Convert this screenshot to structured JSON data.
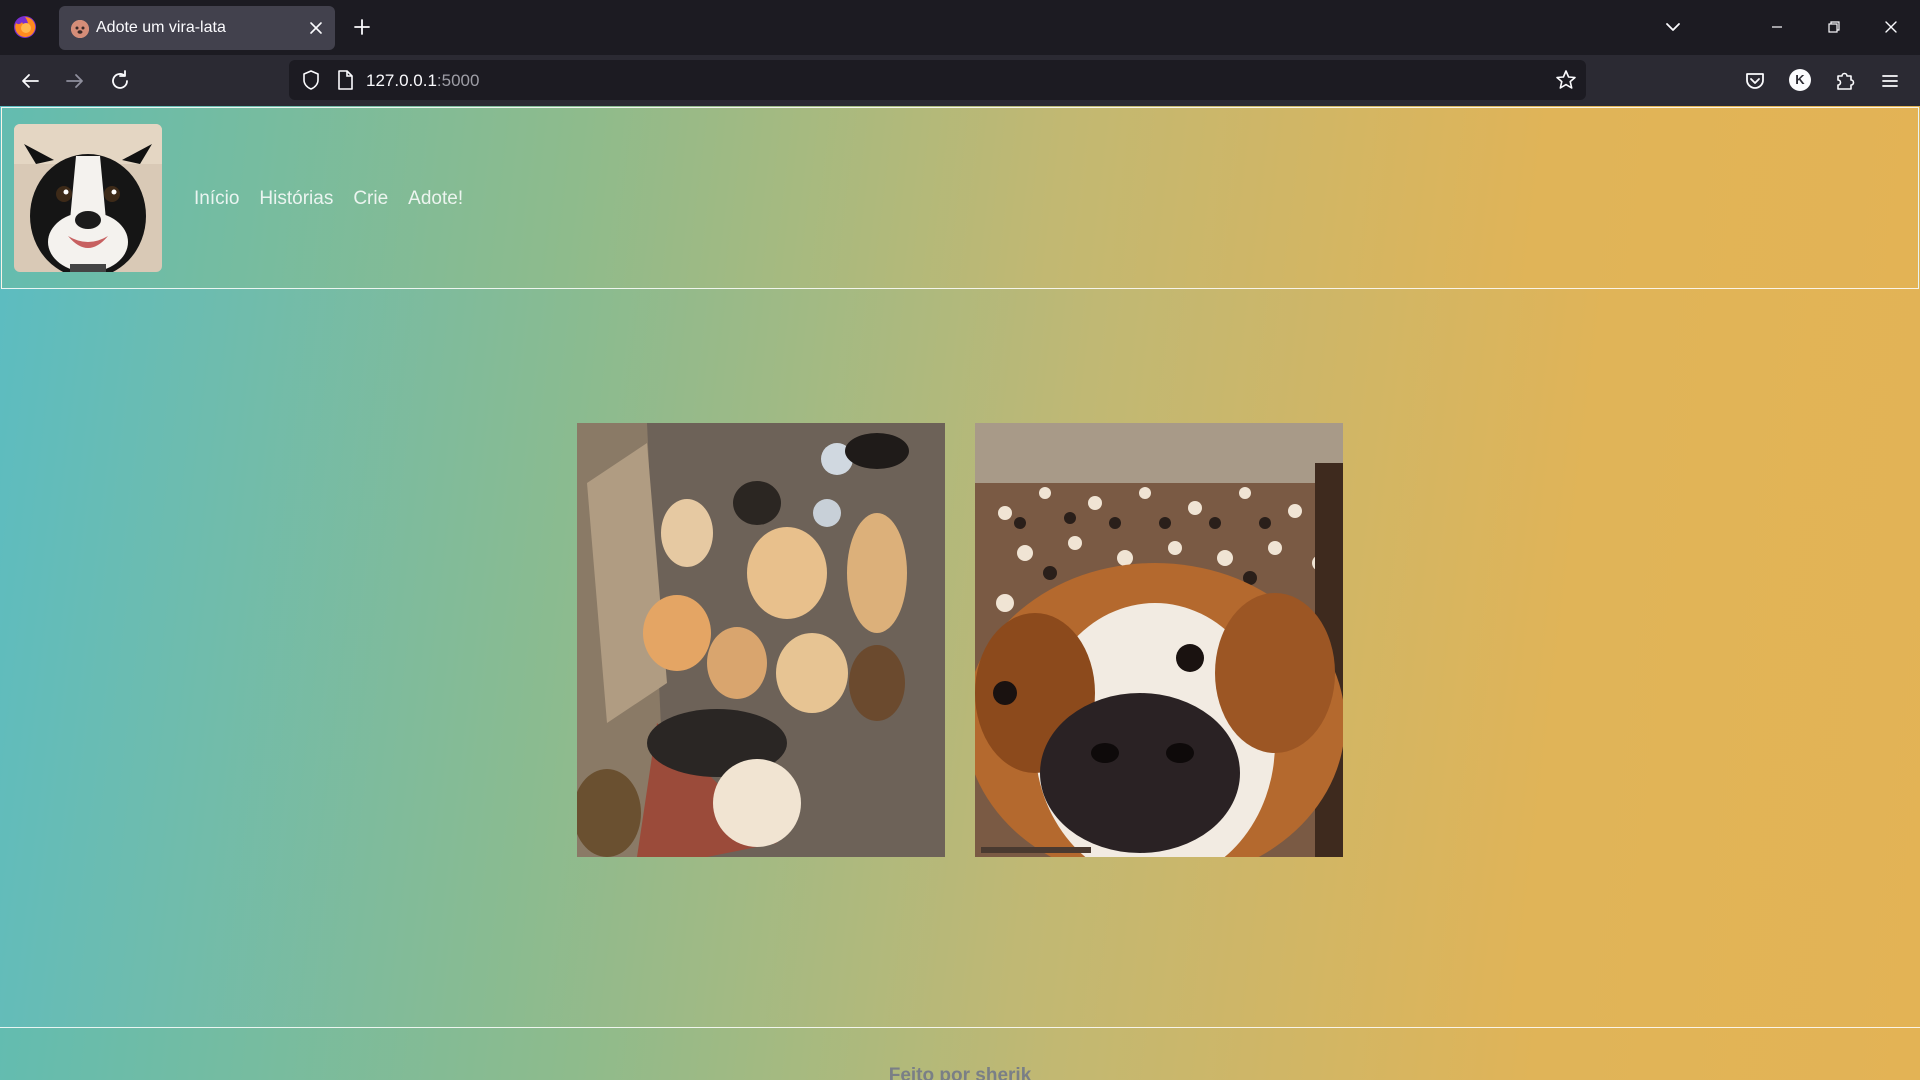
{
  "browser": {
    "tab": {
      "title": "Adote um vira-lata"
    },
    "url": {
      "host": "127.0.0.1",
      "port": ":5000"
    }
  },
  "site": {
    "menu": [
      {
        "label": "Início"
      },
      {
        "label": "Histórias"
      },
      {
        "label": "Crie"
      },
      {
        "label": "Adote!"
      }
    ],
    "footer": {
      "text": "Feito por sherik"
    }
  },
  "icons": {
    "browser": "firefox-icon",
    "favicon": "dog-face-icon",
    "shield": "shield-icon",
    "page": "page-icon",
    "bookmark": "star-icon",
    "pocket": "pocket-icon",
    "account": "account-icon",
    "extensions": "puzzle-icon",
    "menu": "hamburger-icon"
  },
  "colors": {
    "gradient_left": "#5bbcc2",
    "gradient_right": "#e3b355",
    "tab_bar": "#1c1b22",
    "nav_bar": "#2b2a33"
  }
}
